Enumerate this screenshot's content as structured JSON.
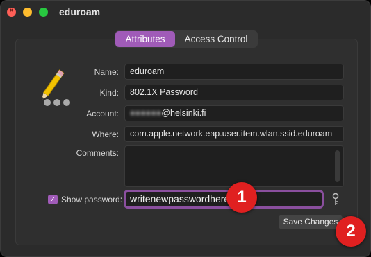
{
  "window": {
    "title": "eduroam"
  },
  "tabs": [
    {
      "label": "Attributes",
      "active": true
    },
    {
      "label": "Access Control",
      "active": false
    }
  ],
  "form": {
    "name_label": "Name:",
    "name_value": "eduroam",
    "kind_label": "Kind:",
    "kind_value": "802.1X Password",
    "account_label": "Account:",
    "account_blurred": "●●●●●●",
    "account_suffix": "@helsinki.fi",
    "where_label": "Where:",
    "where_value": "com.apple.network.eap.user.item.wlan.ssid.eduroam",
    "comments_label": "Comments:",
    "comments_value": "",
    "show_password_label": "Show password:",
    "show_password_checked": true,
    "password_value": "writenewpasswordhere",
    "save_label": "Save Changes"
  },
  "annotations": [
    {
      "label": "1",
      "color": "#e02020"
    },
    {
      "label": "2",
      "color": "#e02020"
    }
  ],
  "colors": {
    "accent": "#a05bb8",
    "background": "#2b2b2b",
    "field": "#1f1f1f"
  },
  "icons": {
    "app": "pencil-keychain-icon",
    "key": "key-icon",
    "check": "checkmark-icon"
  }
}
